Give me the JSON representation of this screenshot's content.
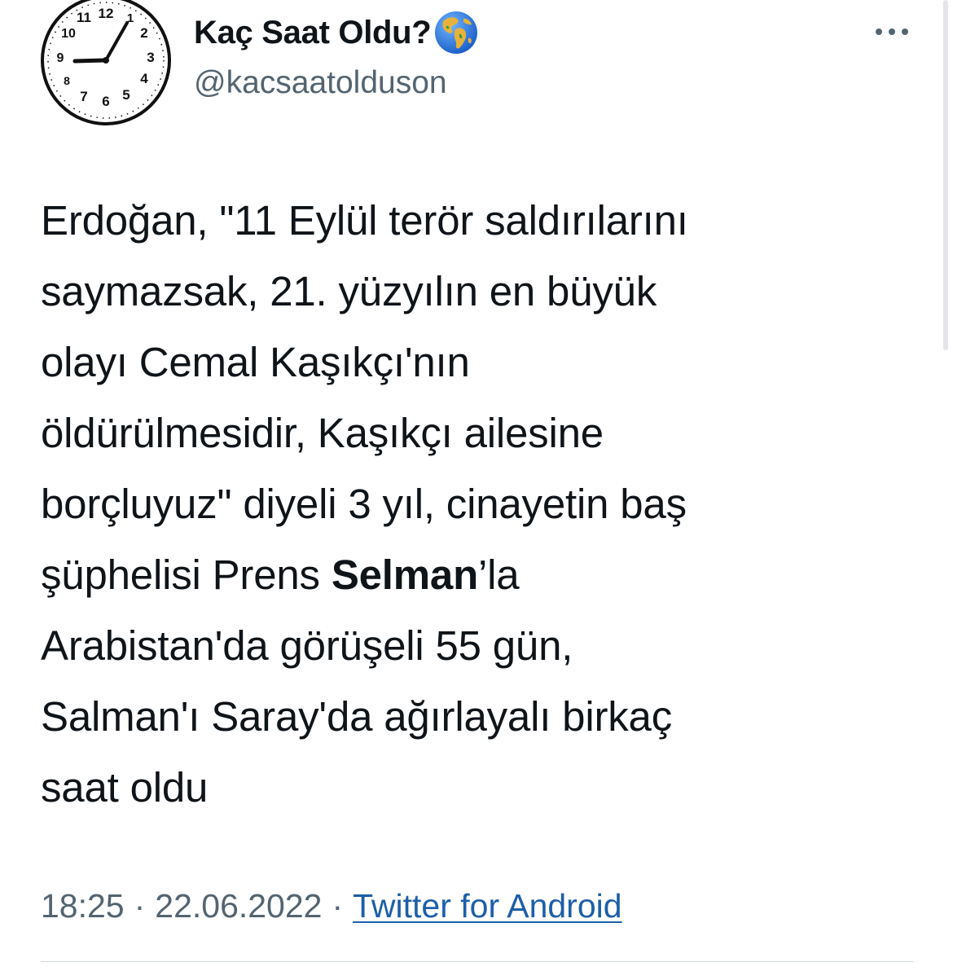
{
  "author": {
    "display_name": "Kaç Saat Oldu?",
    "handle": "@kacsaatolduson",
    "avatar_icon": "clock-avatar-icon",
    "badge_icon": "globe-earth-icon",
    "clock_numbers": [
      "12",
      "1",
      "2",
      "3",
      "4",
      "5",
      "6",
      "7",
      "8",
      "9",
      "10",
      "11"
    ]
  },
  "more_icon": "more-options-icon",
  "tweet": {
    "lines": [
      "Erdoğan, \"11 Eylül terör saldırılarını",
      "saymazsak, 21. yüzyılın en büyük",
      "olayı Cemal Kaşıkçı'nın",
      "öldürülmesidir, Kaşıkçı ailesine",
      "borçluyuz\" diyeli 3 yıl, cinayetin baş"
    ],
    "line6_before": "şüphelisi Prens ",
    "line6_bold": "Selman",
    "line6_after": "’la",
    "lines_after": [
      "Arabistan'da görüşeli 55 gün,",
      "Salman'ı Saray'da ağırlayalı birkaç",
      "saat oldu"
    ]
  },
  "meta": {
    "time": "18:25",
    "separator": "·",
    "date": "22.06.2022",
    "source": "Twitter for Android"
  },
  "colors": {
    "text": "#0f1419",
    "secondary": "#536471",
    "link": "#1d5fa8",
    "divider": "#cfd9de"
  }
}
